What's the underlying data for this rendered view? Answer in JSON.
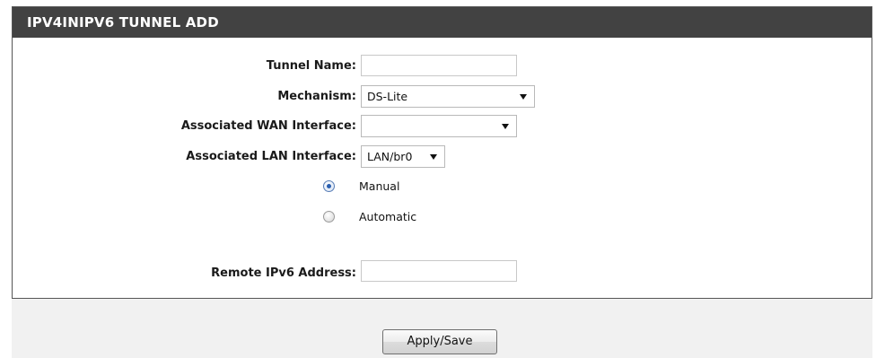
{
  "panel": {
    "title": "IPV4INIPV6 TUNNEL ADD"
  },
  "form": {
    "tunnel_name": {
      "label": "Tunnel Name:",
      "value": ""
    },
    "mechanism": {
      "label": "Mechanism:",
      "selected": "DS-Lite"
    },
    "wan_interface": {
      "label": "Associated WAN Interface:",
      "selected": ""
    },
    "lan_interface": {
      "label": "Associated LAN Interface:",
      "selected": "LAN/br0"
    },
    "mode": {
      "options": [
        {
          "label": "Manual",
          "checked": true
        },
        {
          "label": "Automatic",
          "checked": false
        }
      ]
    },
    "remote_ipv6": {
      "label": "Remote IPv6 Address:",
      "value": ""
    }
  },
  "footer": {
    "apply_label": "Apply/Save"
  },
  "colors": {
    "header_bg": "#424242",
    "footer_bg": "#f1f1f1",
    "radio_dot": "#2a5fb0"
  }
}
